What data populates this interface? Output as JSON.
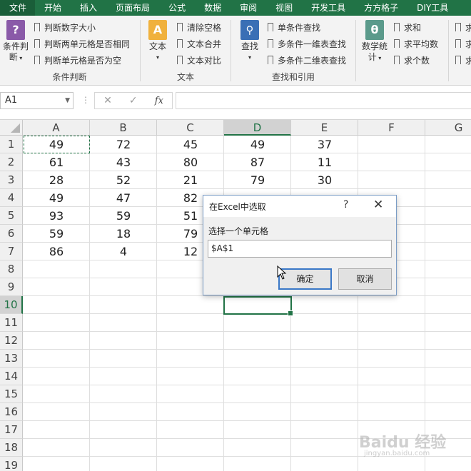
{
  "ribbon_tabs": [
    "文件",
    "开始",
    "插入",
    "页面布局",
    "公式",
    "数据",
    "审阅",
    "视图",
    "开发工具",
    "方方格子",
    "DIY工具"
  ],
  "ribbon": {
    "group_condition": {
      "big_label_1": "条件判",
      "big_label_2": "断",
      "items": [
        "判断数字大小",
        "判断两单元格是否相同",
        "判断单元格是否为空"
      ],
      "label": "条件判断"
    },
    "group_text": {
      "big_label": "文本",
      "items": [
        "清除空格",
        "文本合并",
        "文本对比"
      ],
      "label": "文本"
    },
    "group_lookup": {
      "big_label": "查找",
      "items": [
        "单条件查找",
        "多条件一维表查找",
        "多条件二维表查找"
      ],
      "label": "查找和引用"
    },
    "group_math": {
      "big_label_1": "数学统",
      "big_label_2": "计",
      "items": [
        "求和",
        "求平均数",
        "求个数"
      ],
      "extra_items": [
        "求",
        "求",
        "求"
      ]
    }
  },
  "formula_bar": {
    "name_box": "A1",
    "fx": "fx"
  },
  "grid": {
    "columns": [
      "A",
      "B",
      "C",
      "D",
      "E",
      "F",
      "G"
    ],
    "rows": [
      "1",
      "2",
      "3",
      "4",
      "5",
      "6",
      "7",
      "8",
      "9",
      "10",
      "11",
      "12",
      "13",
      "14",
      "15",
      "16",
      "17",
      "18",
      "19"
    ],
    "cells": [
      [
        "49",
        "72",
        "45",
        "49",
        "37"
      ],
      [
        "61",
        "43",
        "80",
        "87",
        "11"
      ],
      [
        "28",
        "52",
        "21",
        "79",
        "30"
      ],
      [
        "49",
        "47",
        "82",
        "",
        ""
      ],
      [
        "93",
        "59",
        "51",
        "",
        ""
      ],
      [
        "59",
        "18",
        "79",
        "",
        ""
      ],
      [
        "86",
        "4",
        "12",
        "",
        ""
      ]
    ]
  },
  "dialog": {
    "title": "在Excel中选取",
    "help": "?",
    "close": "✕",
    "label": "选择一个单元格",
    "input_value": "$A$1",
    "ok": "确定",
    "cancel": "取消"
  },
  "colors": {
    "excel_green": "#217346",
    "dialog_border": "#7a9cc6",
    "ok_border": "#3a78c7"
  },
  "icons": {
    "condition": "question-mark-icon",
    "text": "letter-a-icon",
    "lookup": "magnifier-icon",
    "math": "theta-icon"
  },
  "watermark": {
    "main": "Baidu 经验",
    "sub": "jingyan.baidu.com"
  }
}
